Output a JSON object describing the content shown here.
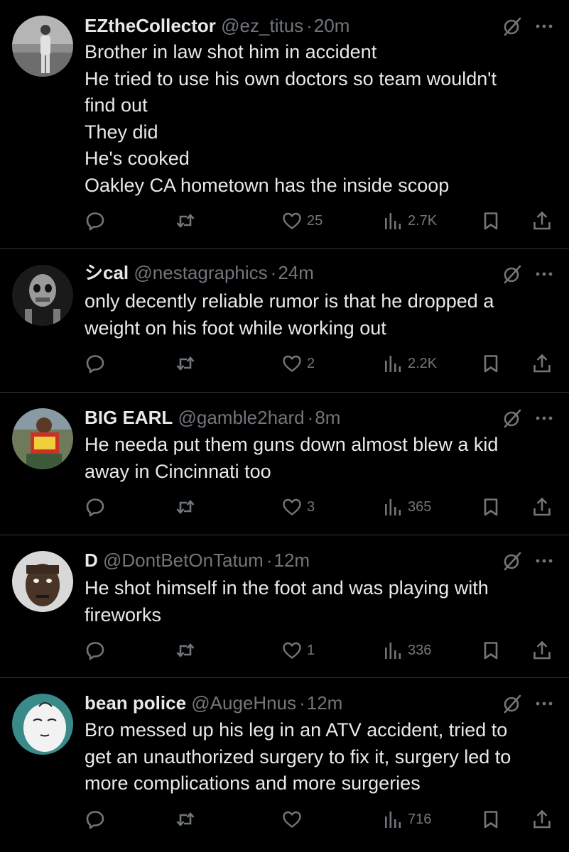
{
  "tweets": [
    {
      "name": "EZtheCollector",
      "handle": "@ez_titus",
      "separator": "·",
      "time": "20m",
      "lines": [
        "Brother in law shot him in accident",
        "He tried to use his own doctors so team wouldn't",
        "find out",
        "They did",
        "He's cooked",
        "Oakley CA hometown has the inside scoop"
      ],
      "likes": "25",
      "views": "2.7K"
    },
    {
      "name": "シcal",
      "handle": "@nestagraphics",
      "separator": "·",
      "time": "24m",
      "lines": [
        "only decently reliable rumor is that he dropped a",
        "weight on his foot while working out"
      ],
      "likes": "2",
      "views": "2.2K"
    },
    {
      "name": "BIG EARL",
      "handle": "@gamble2hard",
      "separator": "·",
      "time": "8m",
      "lines": [
        "He needa put them guns down almost blew a kid",
        "away in Cincinnati too"
      ],
      "likes": "3",
      "views": "365"
    },
    {
      "name": "D",
      "handle": "@DontBetOnTatum",
      "separator": "·",
      "time": "12m",
      "lines": [
        "He shot himself in the foot and was playing with",
        "fireworks"
      ],
      "likes": "1",
      "views": "336"
    },
    {
      "name": "bean police",
      "handle": "@AugeHnus",
      "separator": "·",
      "time": "12m",
      "lines": [
        "Bro messed up his leg in an ATV accident, tried to",
        "get an unauthorized surgery to fix it, surgery led to",
        "more complications and more surgeries"
      ],
      "likes": "",
      "views": "716"
    }
  ],
  "icons": {
    "reply": "reply-icon",
    "retweet": "retweet-icon",
    "like": "heart-icon",
    "views": "views-icon",
    "bookmark": "bookmark-icon",
    "share": "share-icon",
    "grok": "grok-icon",
    "more": "more-icon"
  },
  "colors": {
    "background": "#000000",
    "primary_text": "#e7e9ea",
    "secondary_text": "#71767b",
    "divider": "#2f3336"
  }
}
